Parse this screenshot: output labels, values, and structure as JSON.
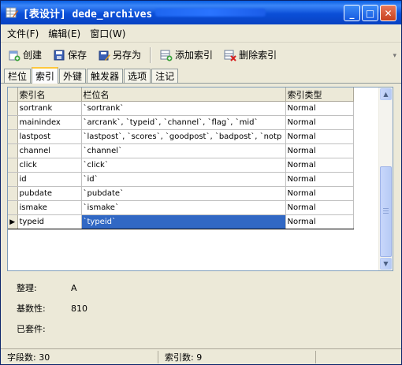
{
  "window": {
    "title": "[表设计] dede_archives",
    "controls": {
      "minimize": "_",
      "maximize": "□",
      "close": "✕"
    }
  },
  "menu": {
    "items": [
      "文件(F)",
      "编辑(E)",
      "窗口(W)"
    ]
  },
  "toolbar": {
    "create": "创建",
    "save": "保存",
    "save_as": "另存为",
    "add_index": "添加索引",
    "delete_index": "删除索引"
  },
  "tabs": [
    "栏位",
    "索引",
    "外键",
    "触发器",
    "选项",
    "注记"
  ],
  "active_tab": "索引",
  "grid": {
    "columns": [
      "索引名",
      "栏位名",
      "索引类型"
    ],
    "rows": [
      {
        "name": "sortrank",
        "fields": "`sortrank`",
        "type": "Normal"
      },
      {
        "name": "mainindex",
        "fields": "`arcrank`, `typeid`, `channel`, `flag`, `mid`",
        "type": "Normal"
      },
      {
        "name": "lastpost",
        "fields": "`lastpost`, `scores`, `goodpost`, `badpost`, `notp",
        "type": "Normal"
      },
      {
        "name": "channel",
        "fields": "`channel`",
        "type": "Normal"
      },
      {
        "name": "click",
        "fields": "`click`",
        "type": "Normal"
      },
      {
        "name": "id",
        "fields": "`id`",
        "type": "Normal"
      },
      {
        "name": "pubdate",
        "fields": "`pubdate`",
        "type": "Normal"
      },
      {
        "name": "ismake",
        "fields": "`ismake`",
        "type": "Normal"
      },
      {
        "name": "typeid",
        "fields": "`typeid`",
        "type": "Normal"
      }
    ],
    "selected_row": "typeid"
  },
  "props": {
    "collation_label": "整理:",
    "collation_value": "A",
    "cardinality_label": "基数性:",
    "cardinality_value": "810",
    "packed_label": "已套件:",
    "packed_value": ""
  },
  "status": {
    "field_count": "字段数: 30",
    "index_count": "索引数: 9"
  },
  "colors": {
    "titlebar": "#0B4FD8",
    "selection": "#3168C4",
    "active_tab_accent": "#FFC83C"
  }
}
